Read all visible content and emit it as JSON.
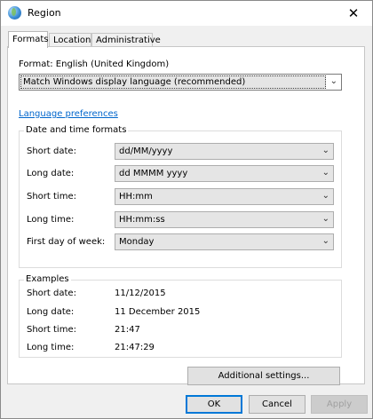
{
  "window": {
    "title": "Region",
    "close_glyph": "✕"
  },
  "tabs": [
    {
      "label": "Formats",
      "active": true
    },
    {
      "label": "Location",
      "active": false
    },
    {
      "label": "Administrative",
      "active": false
    }
  ],
  "format": {
    "label": "Format: English (United Kingdom)",
    "value": "Match Windows display language (recommended)"
  },
  "language_link": "Language preferences",
  "date_time": {
    "title": "Date and time formats",
    "rows": [
      {
        "label": "Short date:",
        "value": "dd/MM/yyyy"
      },
      {
        "label": "Long date:",
        "value": "dd MMMM yyyy"
      },
      {
        "label": "Short time:",
        "value": "HH:mm"
      },
      {
        "label": "Long time:",
        "value": "HH:mm:ss"
      },
      {
        "label": "First day of week:",
        "value": "Monday"
      }
    ]
  },
  "examples": {
    "title": "Examples",
    "rows": [
      {
        "label": "Short date:",
        "value": "11/12/2015"
      },
      {
        "label": "Long date:",
        "value": "11 December 2015"
      },
      {
        "label": "Short time:",
        "value": "21:47"
      },
      {
        "label": "Long time:",
        "value": "21:47:29"
      }
    ]
  },
  "buttons": {
    "additional": "Additional settings...",
    "ok": "OK",
    "cancel": "Cancel",
    "apply": "Apply"
  },
  "icons": {
    "dropdown": "⌄"
  },
  "colors": {
    "link": "#0066cc",
    "default_button_border": "#0078d7"
  }
}
